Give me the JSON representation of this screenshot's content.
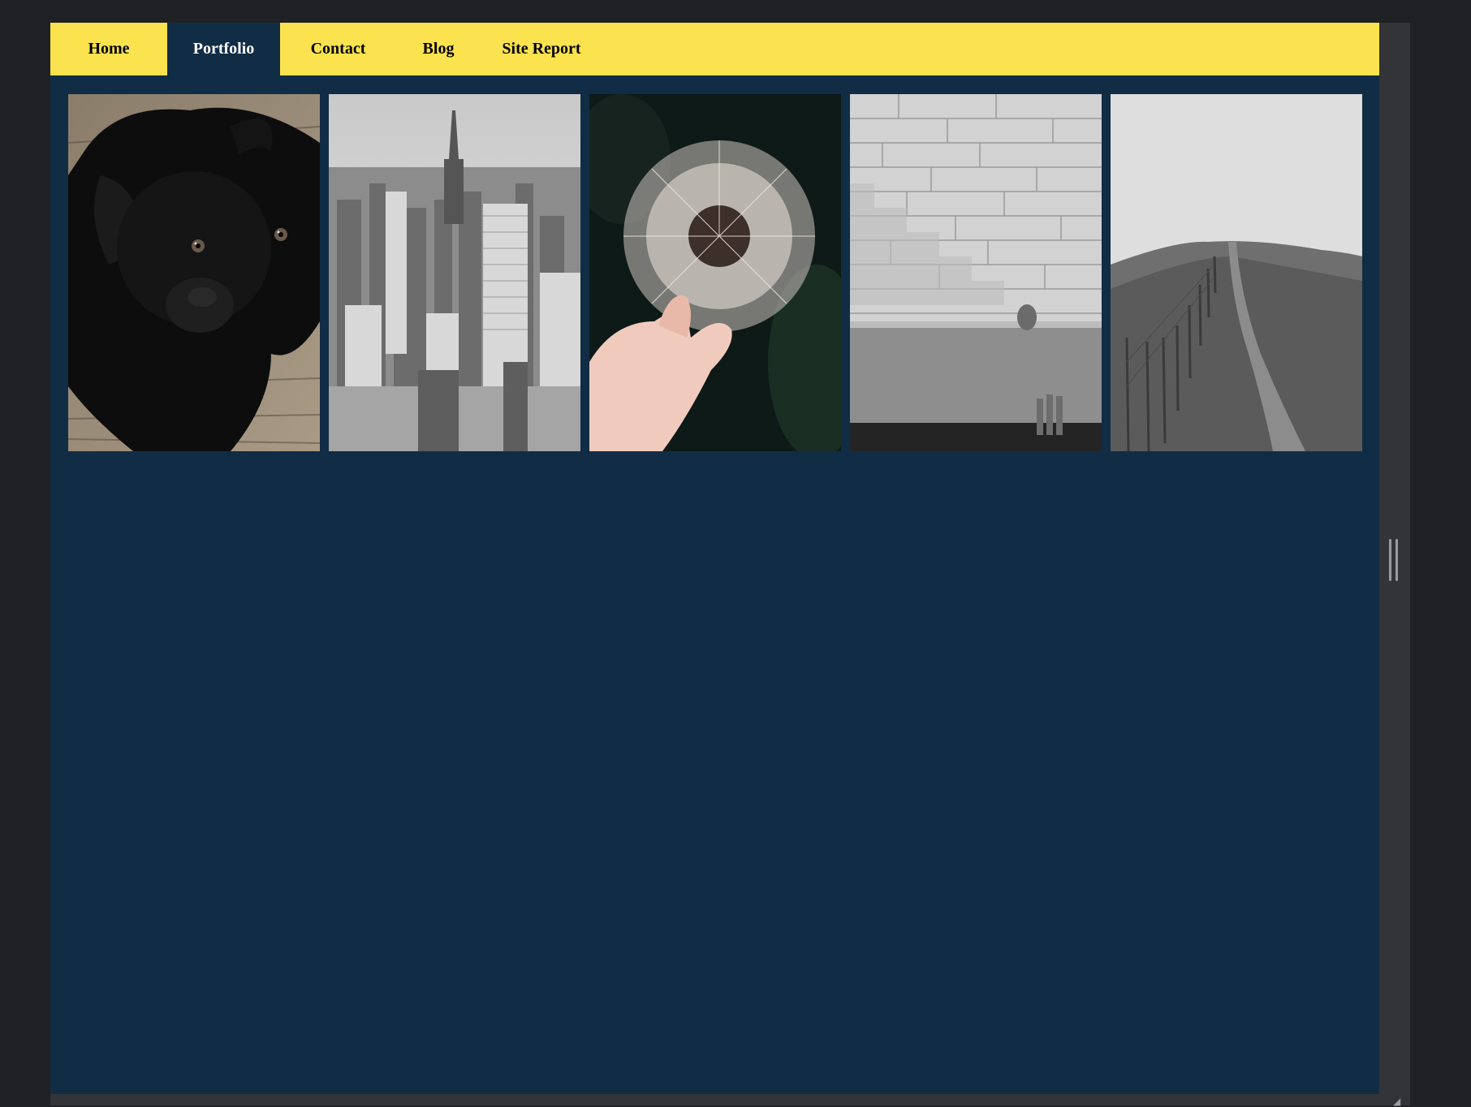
{
  "nav": {
    "items": [
      {
        "label": "Home",
        "active": false
      },
      {
        "label": "Portfolio",
        "active": true
      },
      {
        "label": "Contact",
        "active": false
      },
      {
        "label": "Blog",
        "active": false
      },
      {
        "label": "Site Report",
        "active": false
      }
    ]
  },
  "gallery": {
    "images": [
      {
        "subject": "black-puppy-on-wooden-floor"
      },
      {
        "subject": "new-york-skyline-black-and-white"
      },
      {
        "subject": "hand-holding-dandelion"
      },
      {
        "subject": "stone-wall-with-steps-by-water"
      },
      {
        "subject": "hill-path-with-fence"
      }
    ]
  },
  "colors": {
    "nav_background": "#fbe34f",
    "page_background": "#112d45",
    "active_text": "#ffffff",
    "chrome": "#202124",
    "scrollbar": "#333438"
  },
  "icons": {
    "scroll_grip": "scroll-grip-icon",
    "resize_corner": "resize-corner-icon"
  }
}
